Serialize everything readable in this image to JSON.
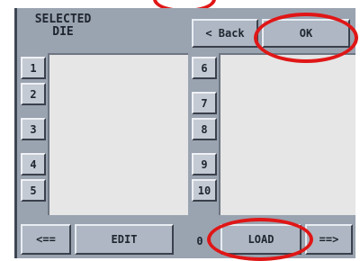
{
  "header": {
    "title": "SELECTED DIE"
  },
  "top_buttons": {
    "back": "< Back",
    "ok": "OK"
  },
  "left_dies": [
    "1",
    "2",
    "3",
    "4",
    "5"
  ],
  "right_dies": [
    "6",
    "7",
    "8",
    "9",
    "10"
  ],
  "bottom_bar": {
    "prev": "<==",
    "edit": "EDIT",
    "count": "0",
    "load": "LOAD",
    "next": "==>"
  },
  "colors": {
    "highlight": "#e01616",
    "panel": "#e6e6e6",
    "screen": "#9aa3b0"
  }
}
